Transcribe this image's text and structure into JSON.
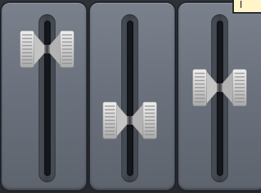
{
  "mixer": {
    "faders": [
      {
        "name": "fader-1",
        "level": 0.88
      },
      {
        "name": "fader-2",
        "level": 0.33
      },
      {
        "name": "fader-3",
        "level": 0.58
      }
    ]
  },
  "tooltip": {
    "text": "I"
  },
  "colors": {
    "panel": "#6b727d",
    "groove": "#14171b",
    "knob": "#d2d2d2",
    "tooltip_bg": "#fff5c8"
  }
}
